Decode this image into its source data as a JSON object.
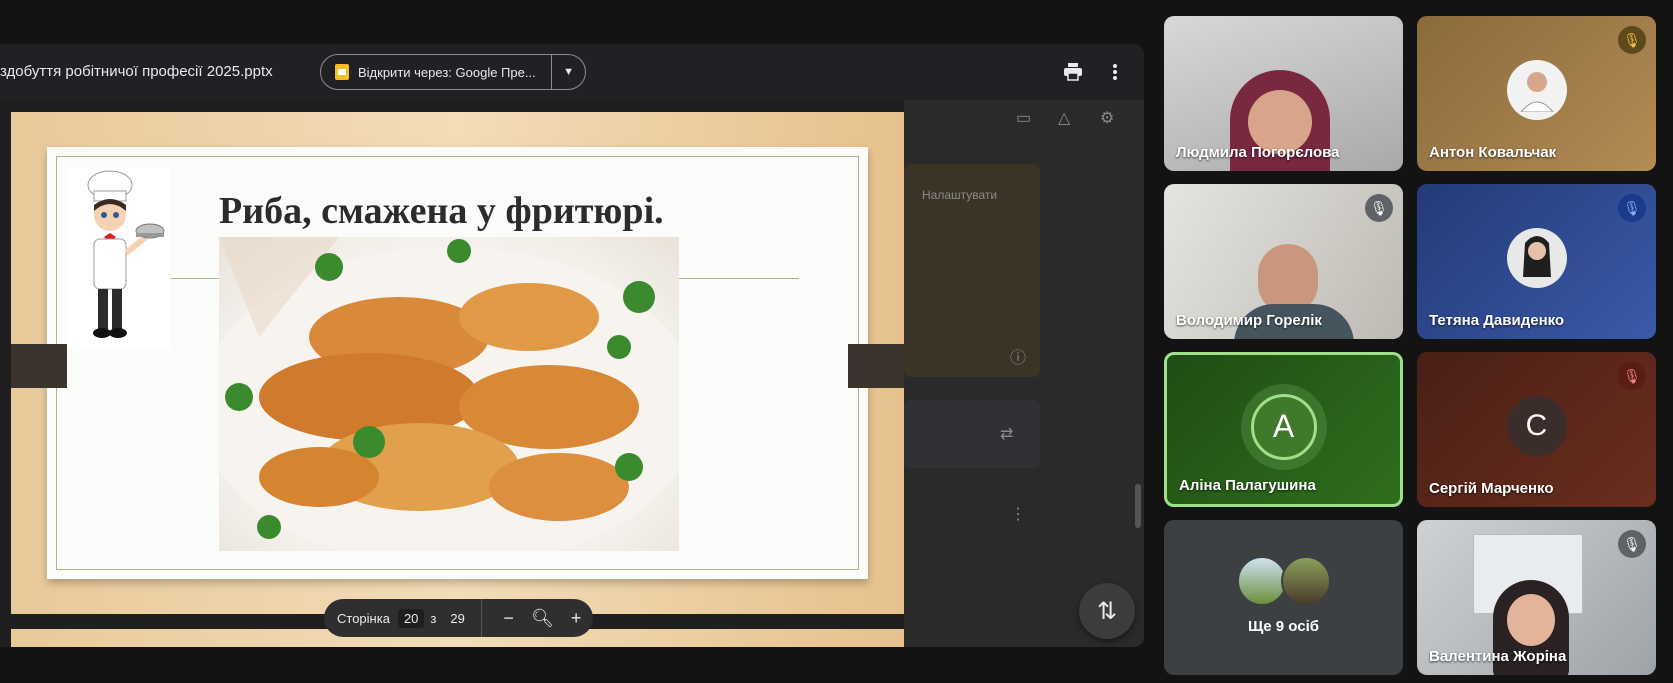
{
  "presentation": {
    "file_name": "здобуття робітничої професії 2025.pptx",
    "open_with_label": "Відкрити через: Google Пре...",
    "slide": {
      "title": "Риба, смажена у фритюрі."
    },
    "pager": {
      "page_label": "Сторінка",
      "current_page": "20",
      "of_label": "з",
      "total_pages": "29"
    },
    "underlying": {
      "configure_label": "Налаштувати"
    }
  },
  "participants": [
    {
      "name": "Людмила Погорєлова",
      "muted": false,
      "type": "video"
    },
    {
      "name": "Антон Ковальчак",
      "muted": true,
      "type": "photo"
    },
    {
      "name": "Володимир Горелік",
      "muted": true,
      "type": "video"
    },
    {
      "name": "Тетяна Давиденко",
      "muted": true,
      "type": "photo"
    },
    {
      "name": "Аліна Палагушина",
      "muted": false,
      "type": "initial",
      "initial": "A",
      "speaking": true
    },
    {
      "name": "Сергій Марченко",
      "muted": true,
      "type": "initial",
      "initial": "C"
    },
    {
      "type": "more",
      "label": "Ще 9 осіб"
    },
    {
      "name": "Валентина Жоріна",
      "muted": true,
      "type": "video"
    }
  ],
  "colors": {
    "speaking_border": "#9fe08a",
    "muted_badge_gold": "#5c4a1a",
    "muted_badge_blue": "#1a3a8a",
    "muted_badge_red": "#5a1d15"
  }
}
